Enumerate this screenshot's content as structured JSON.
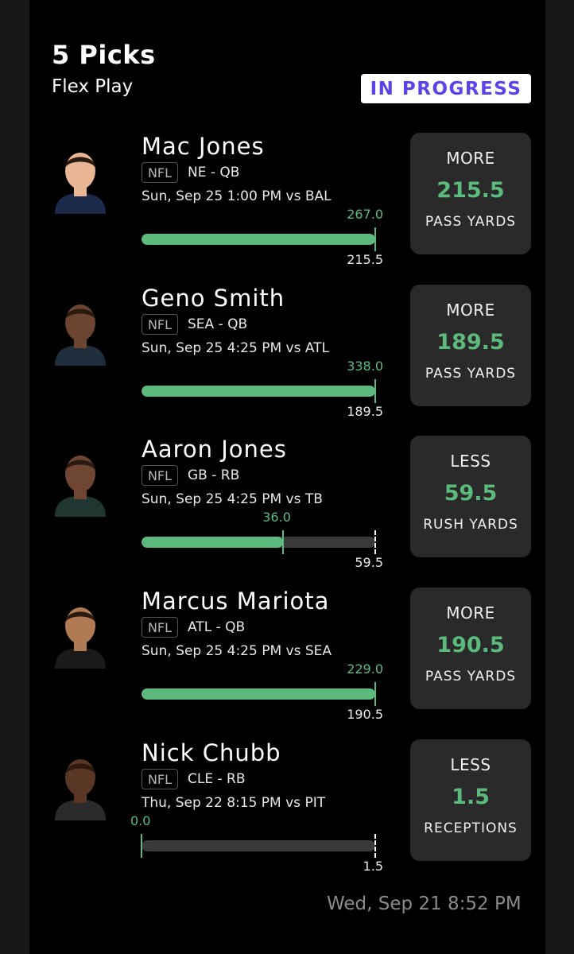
{
  "header": {
    "pick_count": "5 Picks",
    "play_type": "Flex Play",
    "status": "IN PROGRESS"
  },
  "colors": {
    "accent_green": "#5cba7d",
    "status_purple": "#5b43e8",
    "background": "#000000",
    "card": "#2a2a2a"
  },
  "picks": [
    {
      "player": "Mac Jones",
      "league": "NFL",
      "team_pos": "NE - QB",
      "game": "Sun, Sep 25 1:00 PM  vs BAL",
      "direction": "MORE",
      "line": "215.5",
      "stat": "PASS YARDS",
      "actual": "267.0",
      "progress": 1.0,
      "actual_fraction": 1.0,
      "avatar_icon": "player-headshot-icon",
      "jersey_color": "#1b2a4a",
      "skin_color": "#e9b796"
    },
    {
      "player": "Geno Smith",
      "league": "NFL",
      "team_pos": "SEA - QB",
      "game": "Sun, Sep 25 4:25 PM  vs ATL",
      "direction": "MORE",
      "line": "189.5",
      "stat": "PASS YARDS",
      "actual": "338.0",
      "progress": 1.0,
      "actual_fraction": 1.0,
      "avatar_icon": "player-headshot-icon",
      "jersey_color": "#1e2e3a",
      "skin_color": "#6b4530"
    },
    {
      "player": "Aaron Jones",
      "league": "NFL",
      "team_pos": "GB - RB",
      "game": "Sun, Sep 25 4:25 PM  vs TB",
      "direction": "LESS",
      "line": "59.5",
      "stat": "RUSH YARDS",
      "actual": "36.0",
      "progress": 0.605,
      "actual_fraction": 0.605,
      "avatar_icon": "player-headshot-icon",
      "jersey_color": "#203731",
      "skin_color": "#6e4632"
    },
    {
      "player": "Marcus Mariota",
      "league": "NFL",
      "team_pos": "ATL - QB",
      "game": "Sun, Sep 25 4:25 PM  vs SEA",
      "direction": "MORE",
      "line": "190.5",
      "stat": "PASS YARDS",
      "actual": "229.0",
      "progress": 1.0,
      "actual_fraction": 1.0,
      "avatar_icon": "player-headshot-icon",
      "jersey_color": "#1a1a1a",
      "skin_color": "#b07a55"
    },
    {
      "player": "Nick Chubb",
      "league": "NFL",
      "team_pos": "CLE - RB",
      "game": "Thu, Sep 22 8:15 PM  vs PIT",
      "direction": "LESS",
      "line": "1.5",
      "stat": "RECEPTIONS",
      "actual": "0.0",
      "progress": 0.0,
      "actual_fraction": 0.0,
      "avatar_icon": "player-headshot-icon",
      "jersey_color": "#2b2b2b",
      "skin_color": "#5a3624"
    }
  ],
  "footer": {
    "timestamp": "Wed, Sep 21 8:52 PM"
  }
}
